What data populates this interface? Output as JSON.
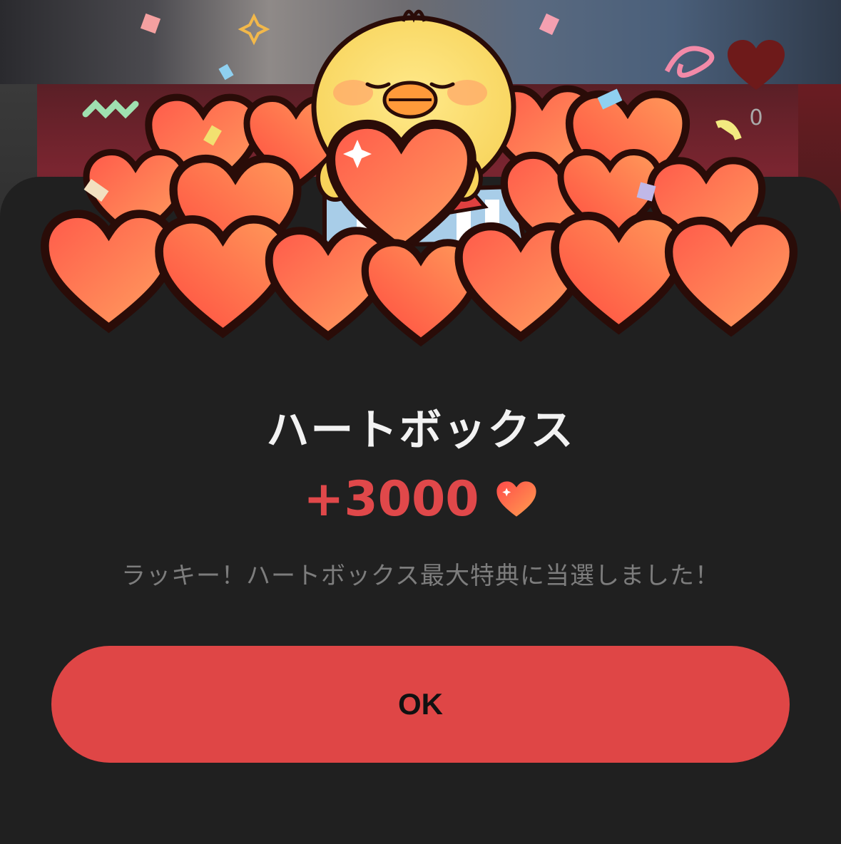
{
  "modal": {
    "title": "ハートボックス",
    "reward_amount": "+3000",
    "message": "ラッキー！ハートボックス最大特典に当選しました！",
    "ok_label": "OK",
    "reward_icon": "heart-icon"
  },
  "background": {
    "like_count": "0",
    "like_icon": "heart-icon"
  },
  "colors": {
    "accent": "#df4646",
    "reward_text": "#e0484a",
    "sheet_bg": "#202020",
    "title_text": "#f2f2f2",
    "message_text": "#7d7d7d"
  }
}
